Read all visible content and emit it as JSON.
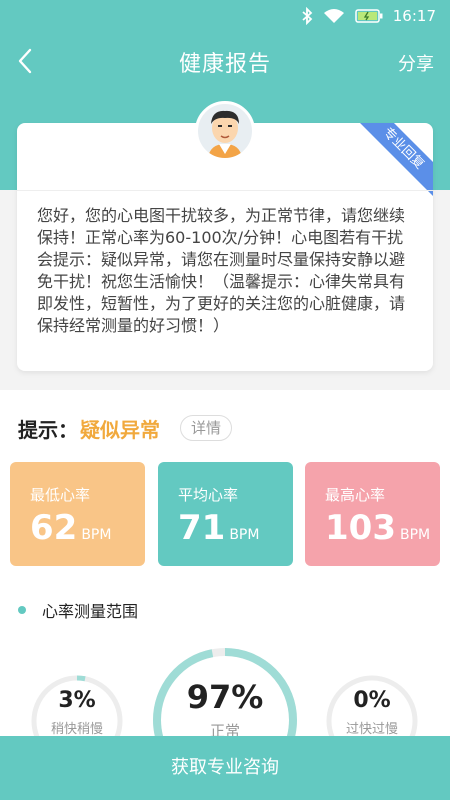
{
  "status_bar": {
    "time": "16:17",
    "icons": [
      "bluetooth-icon",
      "wifi-icon",
      "battery-icon"
    ]
  },
  "header": {
    "title": "健康报告",
    "share_label": "分享",
    "back_icon": "chevron-left-icon"
  },
  "card": {
    "ribbon_label": "专业回复",
    "message": "您好，您的心电图干扰较多，为正常节律，请您继续保持！正常心率为60-100次/分钟！心电图若有干扰会提示：疑似异常，请您在测量时尽量保持安静以避免干扰！祝您生活愉快！（温馨提示：心律失常具有即发性，短暂性，为了更好的关注您的心脏健康，请保持经常测量的好习惯！）"
  },
  "tip": {
    "label": "提示：",
    "value": "疑似异常",
    "detail_label": "详情"
  },
  "stats": [
    {
      "label": "最低心率",
      "value": "62",
      "unit": "BPM",
      "color": "#f9c587"
    },
    {
      "label": "平均心率",
      "value": "71",
      "unit": "BPM",
      "color": "#63c9c1"
    },
    {
      "label": "最高心率",
      "value": "103",
      "unit": "BPM",
      "color": "#f5a3ab"
    }
  ],
  "range": {
    "title": "心率测量范围",
    "items": [
      {
        "percent": "3%",
        "label": "稍快稍慢",
        "fraction": 0.03
      },
      {
        "percent": "97%",
        "label": "正常",
        "fraction": 0.97
      },
      {
        "percent": "0%",
        "label": "过快过慢",
        "fraction": 0.0
      }
    ]
  },
  "bottom_button": {
    "label": "获取专业咨询"
  },
  "colors": {
    "primary": "#63c9c1",
    "accent": "#f1a93d",
    "ribbon": "#5b8fe8"
  }
}
